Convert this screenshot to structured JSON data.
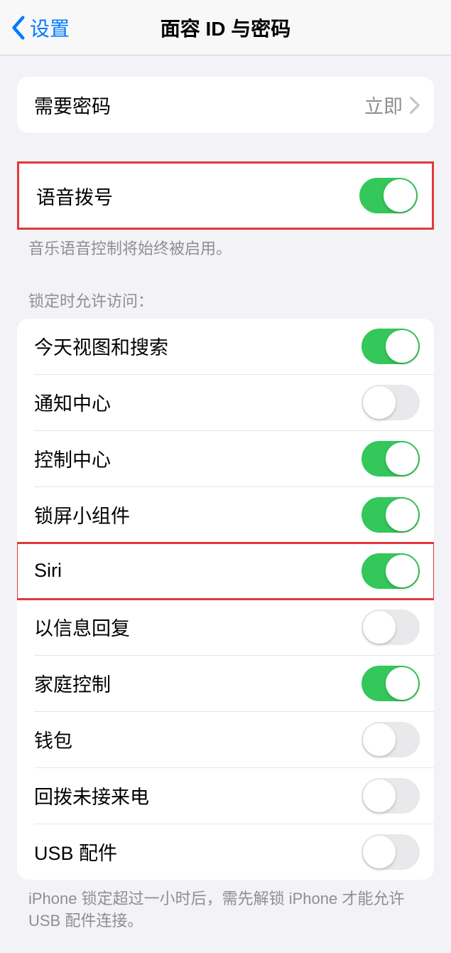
{
  "nav": {
    "back_label": "设置",
    "title": "面容 ID 与密码"
  },
  "require_passcode": {
    "label": "需要密码",
    "value": "立即"
  },
  "voice_dial": {
    "label": "语音拨号",
    "on": true,
    "footer": "音乐语音控制将始终被启用。"
  },
  "lock_access": {
    "header": "锁定时允许访问：",
    "items": [
      {
        "label": "今天视图和搜索",
        "on": true
      },
      {
        "label": "通知中心",
        "on": false
      },
      {
        "label": "控制中心",
        "on": true
      },
      {
        "label": "锁屏小组件",
        "on": true
      },
      {
        "label": "Siri",
        "on": true,
        "highlighted": true
      },
      {
        "label": "以信息回复",
        "on": false
      },
      {
        "label": "家庭控制",
        "on": true
      },
      {
        "label": "钱包",
        "on": false
      },
      {
        "label": "回拨未接来电",
        "on": false
      },
      {
        "label": "USB 配件",
        "on": false
      }
    ],
    "footer": "iPhone 锁定超过一小时后，需先解锁 iPhone 才能允许USB 配件连接。"
  }
}
